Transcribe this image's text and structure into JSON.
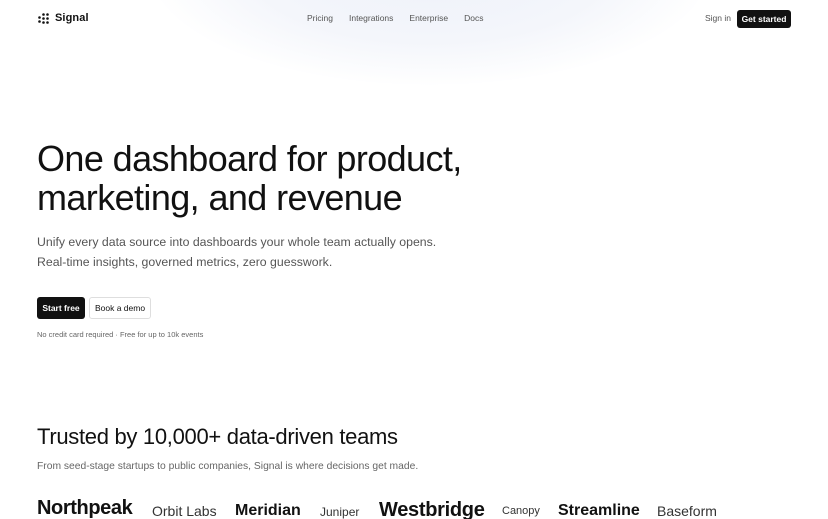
{
  "brand": {
    "name": "Signal",
    "logo_icon": "dot-grid-logo-icon"
  },
  "nav": {
    "links": [
      "Pricing",
      "Integrations",
      "Enterprise",
      "Docs"
    ],
    "sign_in": "Sign in",
    "cta": "Get started"
  },
  "hero": {
    "title_line1": "One dashboard for product,",
    "title_line2": "marketing, and revenue",
    "subtitle": "Unify every data source into dashboards your whole team actually opens. Real-time insights, governed metrics, zero guesswork.",
    "primary_button": "Start free",
    "secondary_button": "Book a demo",
    "note": "No credit card required · Free for up to 10k events"
  },
  "trusted": {
    "title": "Trusted by 10,000+ data-driven teams",
    "subtitle": "From seed-stage startups to public companies, Signal is where decisions get made.",
    "logos": [
      "Northpeak",
      "Orbit Labs",
      "Meridian",
      "Juniper",
      "Westbridge",
      "Canopy",
      "Streamline",
      "Baseform"
    ]
  },
  "colors": {
    "accent": "#111111",
    "muted_text": "#555555",
    "background": "#ffffff"
  }
}
